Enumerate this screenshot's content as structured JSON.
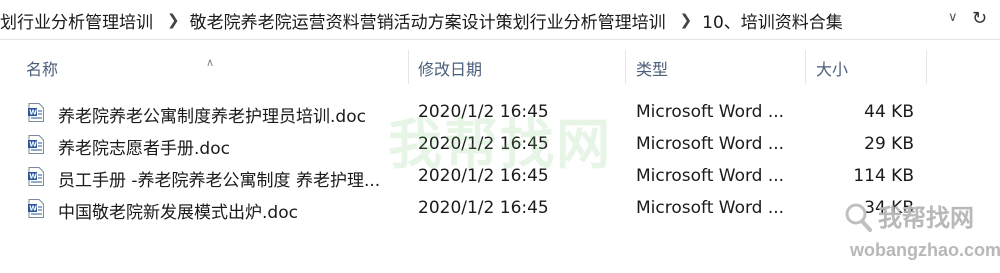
{
  "address_bar": {
    "crumbs": [
      "划行业分析管理培训",
      "敬老院养老院运营资料营销活动方案设计策划行业分析管理培训",
      "10、培训资料合集"
    ]
  },
  "columns": {
    "name": "名称",
    "date": "修改日期",
    "type": "类型",
    "size": "大小"
  },
  "files": [
    {
      "name": "养老院养老公寓制度养老护理员培训.doc",
      "date": "2020/1/2 16:45",
      "type": "Microsoft Word ...",
      "size": "44 KB"
    },
    {
      "name": "养老院志愿者手册.doc",
      "date": "2020/1/2 16:45",
      "type": "Microsoft Word ...",
      "size": "29 KB"
    },
    {
      "name": "员工手册 -养老院养老公寓制度 养老护理...",
      "date": "2020/1/2 16:45",
      "type": "Microsoft Word ...",
      "size": "114 KB"
    },
    {
      "name": "中国敬老院新发展模式出炉.doc",
      "date": "2020/1/2 16:45",
      "type": "Microsoft Word ...",
      "size": "34 KB"
    }
  ],
  "watermark": {
    "center": "我帮找网",
    "brand": "我帮找网",
    "url": "wobangzhao.com"
  }
}
